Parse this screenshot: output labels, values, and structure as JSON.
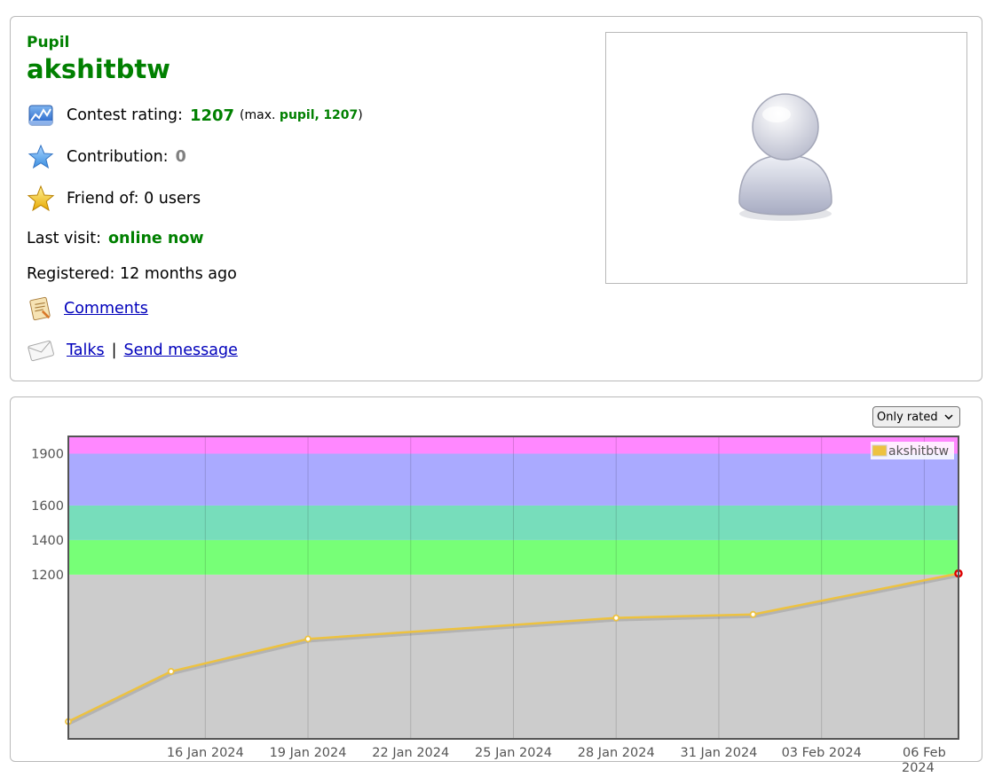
{
  "profile": {
    "rank": "Pupil",
    "handle": "akshitbtw",
    "contest_rating_label": "Contest rating:",
    "contest_rating_value": "1207",
    "max_prefix": "(max.",
    "max_rank": "pupil,",
    "max_rating": "1207",
    "max_suffix": ")",
    "contribution_label": "Contribution:",
    "contribution_value": "0",
    "friend_of": "Friend of: 0 users",
    "last_visit_label": "Last visit:",
    "last_visit_value": "online now",
    "registered": "Registered: 12 months ago",
    "comments_link": "Comments",
    "talks_link": "Talks",
    "separator": "|",
    "send_message_link": "Send message"
  },
  "graph_controls": {
    "filter_selected": "Only rated"
  },
  "colors": {
    "accent_green": "#008000",
    "link_blue": "#0000bb",
    "series": "#edc240",
    "band_gray": "#cccccc",
    "band_green": "#77ff77",
    "band_cyan": "#77ddbb",
    "band_blue": "#aaaaff",
    "band_violet": "#ff88ff"
  },
  "chart_data": {
    "type": "line",
    "x_type": "date",
    "series": [
      {
        "name": "akshitbtw",
        "points": [
          {
            "x": "2024-01-12",
            "y": 350
          },
          {
            "x": "2024-01-15",
            "y": 640
          },
          {
            "x": "2024-01-19",
            "y": 828
          },
          {
            "x": "2024-01-28",
            "y": 950
          },
          {
            "x": "2024-02-01",
            "y": 970
          },
          {
            "x": "2024-02-07",
            "y": 1207
          }
        ]
      }
    ],
    "xticks": [
      {
        "x": "2024-01-16",
        "label": "16 Jan 2024"
      },
      {
        "x": "2024-01-19",
        "label": "19 Jan 2024"
      },
      {
        "x": "2024-01-22",
        "label": "22 Jan 2024"
      },
      {
        "x": "2024-01-25",
        "label": "25 Jan 2024"
      },
      {
        "x": "2024-01-28",
        "label": "28 Jan 2024"
      },
      {
        "x": "2024-01-31",
        "label": "31 Jan 2024"
      },
      {
        "x": "2024-02-03",
        "label": "03 Feb 2024"
      },
      {
        "x": "2024-02-06",
        "label": "06 Feb 2024"
      }
    ],
    "yticks": [
      1200,
      1400,
      1600,
      1900
    ],
    "xlim": [
      "2024-01-12",
      "2024-02-07"
    ],
    "ylim": [
      250,
      2000
    ],
    "bands": [
      {
        "from": 0,
        "to": 1200,
        "color": "#cccccc"
      },
      {
        "from": 1200,
        "to": 1400,
        "color": "#77ff77"
      },
      {
        "from": 1400,
        "to": 1600,
        "color": "#77ddbb"
      },
      {
        "from": 1600,
        "to": 1900,
        "color": "#aaaaff"
      },
      {
        "from": 1900,
        "to": 2100,
        "color": "#ff88ff"
      }
    ],
    "grid": true,
    "legend": "top-right"
  }
}
